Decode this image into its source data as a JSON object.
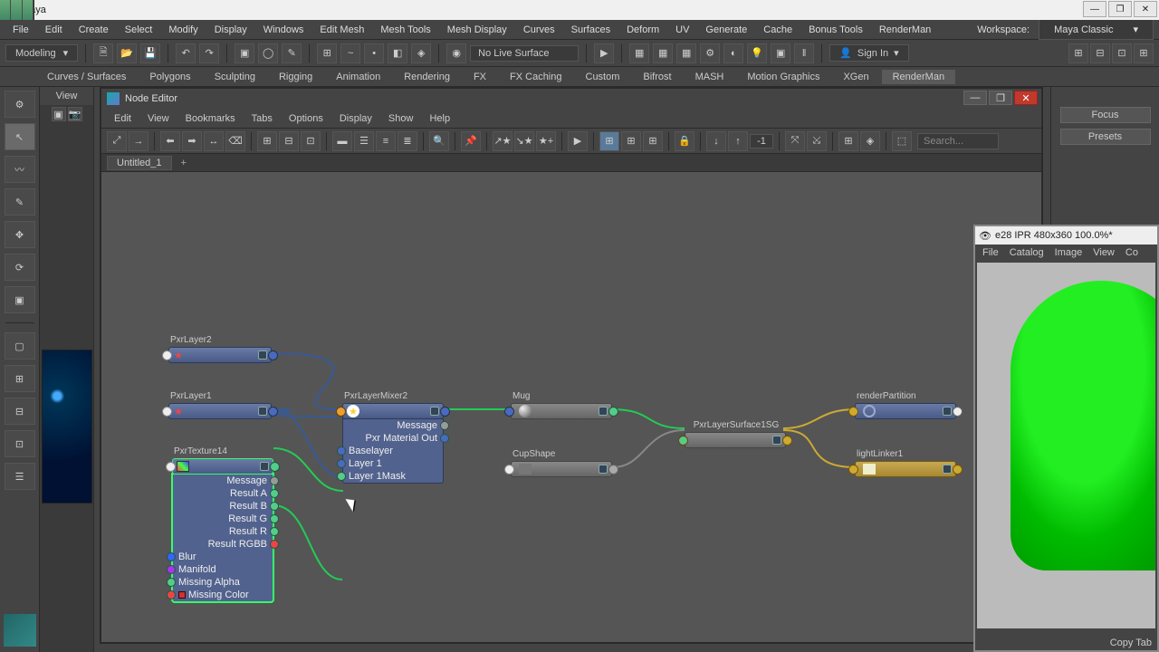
{
  "app": {
    "title": "Maya"
  },
  "winbtns": {
    "min": "—",
    "max": "❐",
    "close": "✕"
  },
  "menubar": [
    "File",
    "Edit",
    "Create",
    "Select",
    "Modify",
    "Display",
    "Windows",
    "Edit Mesh",
    "Mesh Tools",
    "Mesh Display",
    "Curves",
    "Surfaces",
    "Deform",
    "UV",
    "Generate",
    "Cache",
    "Bonus Tools",
    "RenderMan"
  ],
  "workspace": {
    "label": "Workspace:",
    "value": "Maya Classic"
  },
  "shelf": {
    "mode": "Modeling",
    "nolive": "No Live Surface",
    "signin": "Sign In"
  },
  "tabs": [
    "Curves / Surfaces",
    "Polygons",
    "Sculpting",
    "Rigging",
    "Animation",
    "Rendering",
    "FX",
    "FX Caching",
    "Custom",
    "Bifrost",
    "MASH",
    "Motion Graphics",
    "XGen",
    "RenderMan"
  ],
  "viewpanel_head": "View",
  "nodeEditor": {
    "title": "Node Editor",
    "menus": [
      "Edit",
      "View",
      "Bookmarks",
      "Tabs",
      "Options",
      "Display",
      "Show",
      "Help"
    ],
    "search_placeholder": "Search...",
    "numfield": "-1",
    "tab": "Untitled_1",
    "plus": "+"
  },
  "nodes": {
    "pxrLayer2": "PxrLayer2",
    "pxrLayer1": "PxrLayer1",
    "pxrTexture14": "PxrTexture14",
    "texRows": {
      "msg": "Message",
      "ra": "Result A",
      "rb": "Result B",
      "rg": "Result G",
      "rr": "Result R",
      "rrgb": "Result RGBB",
      "blur": "Blur",
      "manifold": "Manifold",
      "malpha": "Missing Alpha",
      "mcolor": "Missing Color"
    },
    "pxrLayerMixer2": "PxrLayerMixer2",
    "mixerRows": {
      "msg": "Message",
      "pmo": "Pxr Material Out",
      "base": "Baselayer",
      "l1": "Layer 1",
      "l1m": "Layer 1Mask"
    },
    "mug": "Mug",
    "cupShape": "CupShape",
    "sg": "PxrLayerSurface1SG",
    "renderPartition": "renderPartition",
    "lightLinker1": "lightLinker1"
  },
  "rightpanel": {
    "focus": "Focus",
    "presets": "Presets"
  },
  "ipr": {
    "title": "e28 IPR 480x360 100.0%*",
    "menus": [
      "File",
      "Catalog",
      "Image",
      "View",
      "Co"
    ],
    "copytab": "Copy Tab"
  }
}
